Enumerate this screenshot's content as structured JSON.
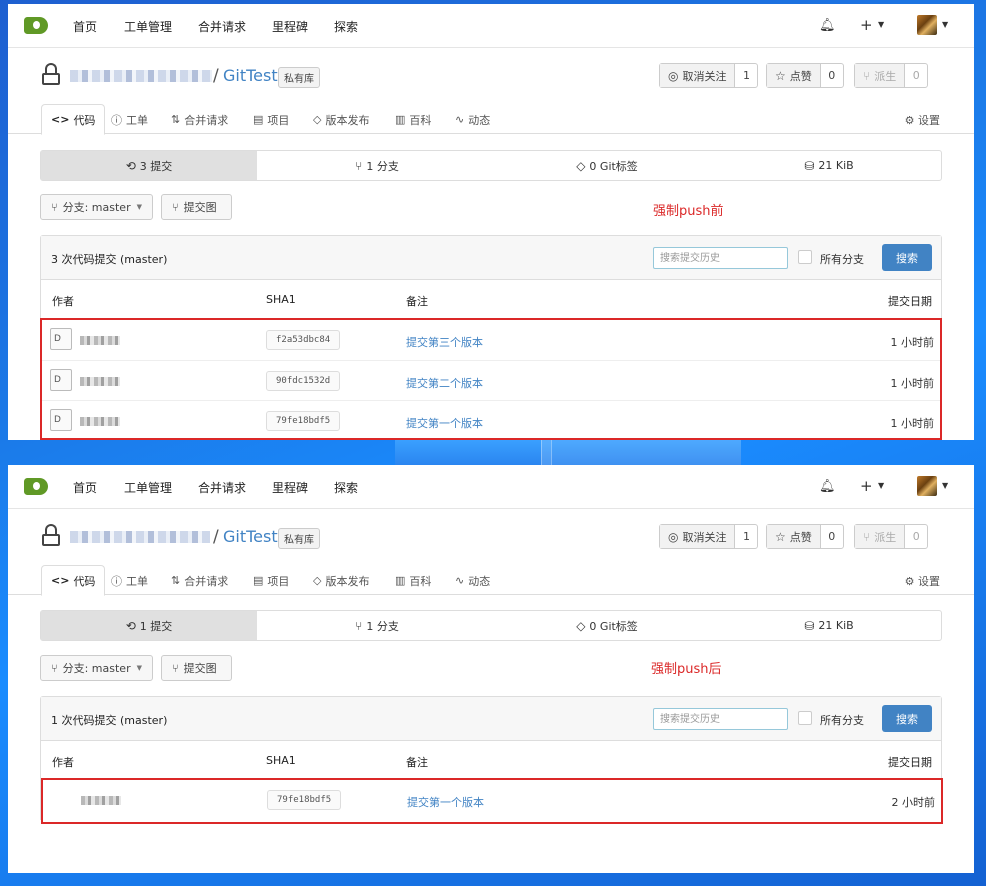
{
  "nav": {
    "items": [
      "首页",
      "工单管理",
      "合并请求",
      "里程碑",
      "探索"
    ],
    "plus": "+"
  },
  "repo": {
    "slash": "/",
    "name": "GitTest",
    "badge": "私有库",
    "actions": {
      "unwatch": {
        "label": "取消关注",
        "count": "1",
        "icon": "eye-slash-icon"
      },
      "star": {
        "label": "点赞",
        "count": "0",
        "icon": "star-icon"
      },
      "fork": {
        "label": "派生",
        "count": "0",
        "icon": "fork-icon"
      }
    },
    "tabs": [
      {
        "label": "代码",
        "icon": "code-icon"
      },
      {
        "label": "工单",
        "icon": "issue-icon"
      },
      {
        "label": "合并请求",
        "icon": "pull-request-icon"
      },
      {
        "label": "项目",
        "icon": "project-icon"
      },
      {
        "label": "版本发布",
        "icon": "tag-icon"
      },
      {
        "label": "百科",
        "icon": "book-icon"
      },
      {
        "label": "动态",
        "icon": "pulse-icon"
      }
    ],
    "settings": "设置"
  },
  "before": {
    "stats": {
      "commits": "3 提交",
      "branches": "1 分支",
      "tags": "0 Git标签",
      "size": "21 KiB"
    },
    "branch_button": "分支: master",
    "graph_button": "提交图",
    "annotation": "强制push前",
    "commit_count": "3 次代码提交 (master)",
    "search_placeholder": "搜索提交历史",
    "all_branches": "所有分支",
    "search_button": "搜索",
    "columns": {
      "author": "作者",
      "sha": "SHA1",
      "message": "备注",
      "date": "提交日期"
    },
    "rows": [
      {
        "avatar_alt": "D",
        "sha": "f2a53dbc84",
        "message": "提交第三个版本",
        "time": "1 小时前"
      },
      {
        "avatar_alt": "D",
        "sha": "90fdc1532d",
        "message": "提交第二个版本",
        "time": "1 小时前"
      },
      {
        "avatar_alt": "D",
        "sha": "79fe18bdf5",
        "message": "提交第一个版本",
        "time": "1 小时前"
      }
    ]
  },
  "after": {
    "stats": {
      "commits": "1 提交",
      "branches": "1 分支",
      "tags": "0 Git标签",
      "size": "21 KiB"
    },
    "branch_button": "分支: master",
    "graph_button": "提交图",
    "annotation": "强制push后",
    "commit_count": "1 次代码提交 (master)",
    "search_placeholder": "搜索提交历史",
    "all_branches": "所有分支",
    "search_button": "搜索",
    "columns": {
      "author": "作者",
      "sha": "SHA1",
      "message": "备注",
      "date": "提交日期"
    },
    "rows": [
      {
        "sha": "79fe18bdf5",
        "message": "提交第一个版本",
        "time": "2 小时前"
      }
    ]
  },
  "colors": {
    "accent": "#4183c4",
    "annotation": "#db2828",
    "logo": "#609926"
  }
}
